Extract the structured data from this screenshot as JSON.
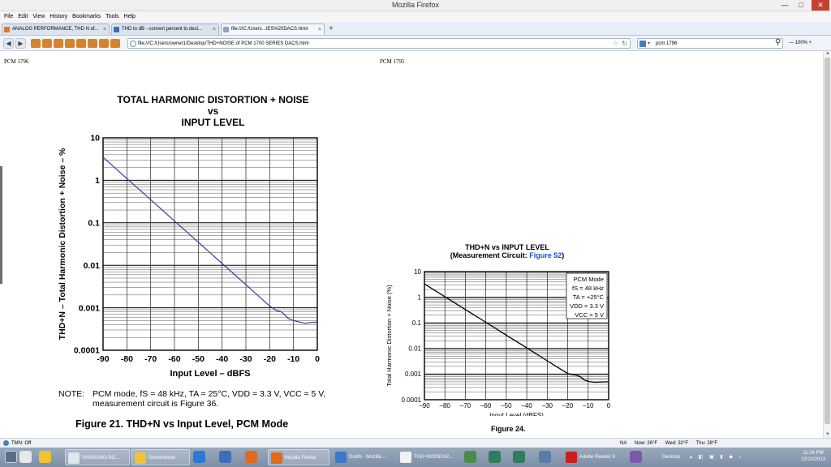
{
  "window": {
    "title": "Mozilla Firefox",
    "minimize": "—",
    "maximize": "□",
    "close": "✕"
  },
  "menu": [
    "File",
    "Edit",
    "View",
    "History",
    "Bookmarks",
    "Tools",
    "Help"
  ],
  "tabs": [
    {
      "label": "ANALOG PERFORMANCE, THD N of...",
      "close": "×"
    },
    {
      "label": "THD to dB - convert percent to deci...",
      "close": "×"
    },
    {
      "label": "file:///C:/Users...IES%20DACS.html",
      "close": "×"
    }
  ],
  "new_tab": "+",
  "nav": {
    "back": "◀",
    "forward": "▶"
  },
  "url": "file:///C:/Users/owner1/Desktop/THD+NOISE of PCM 1700 SERIES DACS.html",
  "search": {
    "value": "pcm 1796",
    "button": "⚲"
  },
  "zoom": "— 100% +",
  "page": {
    "header_left": "PCM 1796",
    "header_right": "PCM 1795",
    "left_chart": {
      "title1": "TOTAL HARMONIC DISTORTION + NOISE",
      "title2": "vs",
      "title3": "INPUT LEVEL",
      "ylabel": "THD+N – Total Harmonic Distortion + Noise – %",
      "xlabel": "Input Level – dBFS",
      "note_label": "NOTE:",
      "note_text": "PCM mode, fS = 48 kHz, TA = 25°C, VDD = 3.3 V, VCC = 5 V, measurement circuit is Figure 36.",
      "caption": "Figure 21. THD+N vs Input Level, PCM Mode"
    },
    "right_chart": {
      "title1": "THD+N vs INPUT LEVEL",
      "title2_prefix": "(Measurement Circuit: ",
      "title2_link": "Figure 52",
      "title2_suffix": ")",
      "ylabel": "Total Harmonic Distortion + Noise (%)",
      "xlabel": "Input Level (dBFS)",
      "legend": [
        "PCM Mode",
        "fS = 48 kHz",
        "TA = +25°C",
        "VDD = 3.3 V",
        "VCC = 5 V"
      ],
      "caption": "Figure 24."
    }
  },
  "chart_data": [
    {
      "type": "line",
      "title": "TOTAL HARMONIC DISTORTION + NOISE vs INPUT LEVEL",
      "xlabel": "Input Level – dBFS",
      "ylabel": "THD+N – Total Harmonic Distortion + Noise – %",
      "xlim": [
        -90,
        0
      ],
      "ylim": [
        0.0001,
        10
      ],
      "yscale": "log",
      "grid": true,
      "color": "#3b3b9a",
      "x_ticks": [
        "-90",
        "-80",
        "-70",
        "-60",
        "-50",
        "-40",
        "-30",
        "-20",
        "-10",
        "0"
      ],
      "y_ticks": [
        "0.0001",
        "0.001",
        "0.01",
        "0.1",
        "1",
        "10"
      ],
      "x": [
        -90,
        -80,
        -70,
        -60,
        -50,
        -40,
        -30,
        -20,
        -17,
        -15,
        -12,
        -10,
        -8,
        -5,
        -3,
        0
      ],
      "y": [
        3.5,
        1.1,
        0.35,
        0.11,
        0.035,
        0.011,
        0.0035,
        0.0011,
        0.00085,
        0.0008,
        0.00055,
        0.0005,
        0.00047,
        0.00043,
        0.00045,
        0.00046
      ]
    },
    {
      "type": "line",
      "title": "THD+N vs INPUT LEVEL",
      "xlabel": "Input Level (dBFS)",
      "ylabel": "Total Harmonic Distortion + Noise (%)",
      "xlim": [
        -90,
        0
      ],
      "ylim": [
        0.0001,
        10
      ],
      "yscale": "log",
      "grid": true,
      "color": "#000000",
      "x_ticks": [
        "–90",
        "–80",
        "–70",
        "–60",
        "–50",
        "–40",
        "–30",
        "–20",
        "–10",
        "0"
      ],
      "y_ticks": [
        "0.0001",
        "0.001",
        "0.01",
        "0.1",
        "1",
        "10"
      ],
      "x": [
        -90,
        -80,
        -70,
        -60,
        -50,
        -40,
        -30,
        -20,
        -16,
        -14,
        -12,
        -10,
        -7,
        -4,
        0
      ],
      "y": [
        3.3,
        1.05,
        0.33,
        0.105,
        0.033,
        0.0105,
        0.0033,
        0.00105,
        0.0009,
        0.0008,
        0.0006,
        0.00052,
        0.00048,
        0.00049,
        0.0005
      ]
    }
  ],
  "taskbar": {
    "tray_label": "TMN: Off",
    "status": [
      "NA",
      "Now: 26°F",
      "Wed: 32°F",
      "Thu: 28°F"
    ],
    "items": [
      "SAMSUNG-SG...",
      "Screenshots",
      "Mozilla Firefox",
      "Drafts - Mozilla ...",
      "THD+NOISE%2...",
      "Adobe Reader X"
    ],
    "desktop": "Desktop",
    "time": "11:34 PM",
    "date": "12/10/2013"
  }
}
